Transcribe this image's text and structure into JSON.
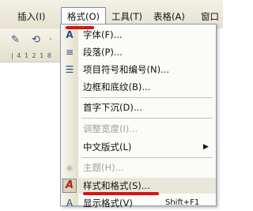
{
  "menubar": {
    "insert": "插入(I)",
    "format": "格式(O)",
    "tools": "工具(T)",
    "table": "表格(A)",
    "window": "窗口"
  },
  "toolbar": {
    "icon1": "✎",
    "icon2": "⟲",
    "icon3": "·",
    "ruler": "| 4 1 2 1 8"
  },
  "menu": {
    "font": "字体(F)...",
    "paragraph": "段落(P)...",
    "bullets": "项目符号和编号(N)...",
    "borders": "边框和底纹(B)...",
    "dropcap": "首字下沉(D)...",
    "adjust_width": "调整宽度(I)...",
    "chinese_layout": "中文版式(L)",
    "theme": "主题(H)...",
    "styles": "样式和格式(S)...",
    "reveal": "显示格式(V)",
    "reveal_shortcut": "Shift+F1",
    "submenu_arrow": "▶",
    "icons": {
      "font": "A",
      "paragraph": "≡",
      "bullets": "☰",
      "theme": "◈",
      "styles": "A",
      "reveal": "A"
    }
  },
  "annotation_color": "#d81414"
}
